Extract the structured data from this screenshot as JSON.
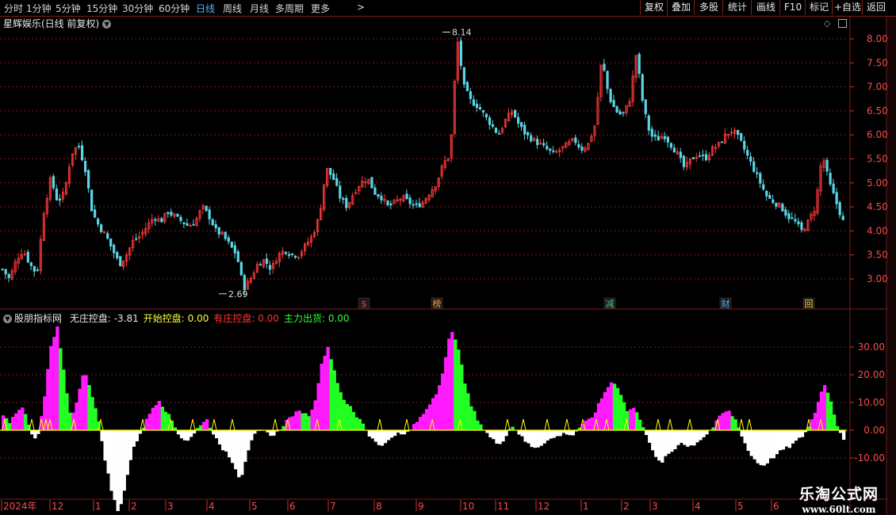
{
  "toolbar": {
    "periods": [
      {
        "label": "分时",
        "x": 5
      },
      {
        "label": "1分钟",
        "x": 33
      },
      {
        "label": "5分钟",
        "x": 70
      },
      {
        "label": "15分钟",
        "x": 109
      },
      {
        "label": "30分钟",
        "x": 154
      },
      {
        "label": "60分钟",
        "x": 200
      },
      {
        "label": "日线",
        "x": 247,
        "active": true
      },
      {
        "label": "周线",
        "x": 281
      },
      {
        "label": "月线",
        "x": 315
      },
      {
        "label": "多周期",
        "x": 347
      },
      {
        "label": "更多",
        "x": 392
      }
    ],
    "more_arrow": ">",
    "right_buttons": [
      {
        "label": "复权",
        "x": 807,
        "w": 34
      },
      {
        "label": "叠加",
        "x": 841,
        "w": 34
      },
      {
        "label": "多股",
        "x": 875,
        "w": 36
      },
      {
        "label": "统计",
        "x": 911,
        "w": 36
      },
      {
        "label": "画线",
        "x": 947,
        "w": 36
      },
      {
        "label": "F10",
        "x": 983,
        "w": 32
      },
      {
        "label": "标记",
        "x": 1015,
        "w": 34
      },
      {
        "label": "+自选",
        "x": 1049,
        "w": 38
      },
      {
        "label": "返回",
        "x": 1087,
        "w": 34
      }
    ]
  },
  "main_chart": {
    "title": "星辉娱乐(日线 前复权)",
    "dropdown_icon": "chevron-down-icon",
    "price_labels": [
      "8.00",
      "7.50",
      "7.00",
      "6.50",
      "6.00",
      "5.50",
      "5.00",
      "4.50",
      "4.00",
      "3.50",
      "3.00"
    ],
    "high_label": "8.14",
    "low_label": "2.69",
    "event_markers": [
      {
        "text": "$",
        "x": 453,
        "color": "#ff3b3b"
      },
      {
        "text": "榜",
        "x": 545,
        "color": "#ff9a3b"
      },
      {
        "text": "减",
        "x": 763,
        "color": "#3bd17a"
      },
      {
        "text": "财",
        "x": 909,
        "color": "#4fb4ff"
      },
      {
        "text": "回",
        "x": 1014,
        "color": "#ffd23b"
      }
    ]
  },
  "indicator": {
    "name": "股朋指标网",
    "items": [
      {
        "label": "无庄控盘:",
        "value": "-3.81",
        "color": "#e8e8e8"
      },
      {
        "label": "开始控盘:",
        "value": "0.00",
        "color": "#ffff33"
      },
      {
        "label": "有庄控盘:",
        "value": "0.00",
        "color": "#ff3333"
      },
      {
        "label": "主力出货:",
        "value": "0.00",
        "color": "#33ff33"
      }
    ],
    "y_labels": [
      "30.00",
      "20.00",
      "10.00",
      "0.00",
      "-10.00"
    ]
  },
  "date_axis": [
    {
      "label": "2024年",
      "x": 2
    },
    {
      "label": "12",
      "x": 63
    },
    {
      "label": "1",
      "x": 118
    },
    {
      "label": "2",
      "x": 163
    },
    {
      "label": "3",
      "x": 209
    },
    {
      "label": "4",
      "x": 261
    },
    {
      "label": "5",
      "x": 315
    },
    {
      "label": "6",
      "x": 363
    },
    {
      "label": "7",
      "x": 414
    },
    {
      "label": "8",
      "x": 472
    },
    {
      "label": "9",
      "x": 525
    },
    {
      "label": "10",
      "x": 581
    },
    {
      "label": "11",
      "x": 625
    },
    {
      "label": "12",
      "x": 676
    },
    {
      "label": "1",
      "x": 733
    },
    {
      "label": "2",
      "x": 784
    },
    {
      "label": "3",
      "x": 820
    },
    {
      "label": "4",
      "x": 874
    },
    {
      "label": "5",
      "x": 928
    },
    {
      "label": "6",
      "x": 973
    }
  ],
  "watermark": {
    "line1": "乐淘公式网",
    "line2": "www.60lt.com"
  },
  "colors": {
    "up": "#ff3b3b",
    "down": "#5bd6e6",
    "magenta": "#ff1aff",
    "green": "#22ff22",
    "white": "#ffffff",
    "yellow": "#ffff00",
    "grid": "#7a1e1e"
  },
  "chart_data": {
    "type": "candlestick",
    "ylim": [
      2.6,
      8.3
    ],
    "close_path": [
      3.2,
      3.0,
      3.4,
      3.6,
      3.3,
      3.1,
      4.4,
      5.1,
      4.6,
      4.8,
      5.6,
      5.8,
      5.3,
      4.4,
      4.1,
      3.9,
      3.6,
      3.3,
      3.5,
      3.8,
      3.9,
      4.1,
      4.3,
      4.2,
      4.4,
      4.3,
      4.2,
      4.1,
      4.2,
      4.5,
      4.3,
      4.0,
      3.9,
      3.7,
      3.5,
      2.8,
      3.0,
      3.3,
      3.4,
      3.2,
      3.5,
      3.6,
      3.5,
      3.5,
      3.7,
      3.9,
      4.3,
      5.3,
      5.1,
      4.7,
      4.5,
      4.8,
      5.0,
      5.1,
      4.8,
      4.7,
      4.5,
      4.6,
      4.7,
      4.6,
      4.5,
      4.6,
      4.8,
      5.0,
      5.4,
      5.6,
      8.0,
      7.0,
      6.7,
      6.6,
      6.4,
      6.2,
      6.0,
      6.3,
      6.5,
      6.2,
      6.0,
      5.9,
      5.8,
      5.7,
      5.6,
      5.7,
      5.8,
      5.9,
      5.7,
      5.8,
      6.2,
      7.6,
      6.8,
      6.5,
      6.4,
      6.7,
      7.7,
      6.6,
      6.0,
      5.9,
      6.0,
      5.8,
      5.6,
      5.3,
      5.5,
      5.6,
      5.5,
      5.7,
      5.8,
      6.0,
      6.1,
      5.9,
      5.6,
      5.3,
      5.0,
      4.7,
      4.6,
      4.5,
      4.3,
      4.2,
      4.0,
      4.2,
      4.5,
      5.6,
      5.0,
      4.6,
      4.2
    ],
    "osc_path": [
      5,
      3,
      7,
      9,
      -1,
      -4,
      10,
      30,
      37,
      20,
      4,
      12,
      22,
      14,
      4,
      -10,
      -22,
      -30,
      -20,
      -8,
      -2,
      3,
      8,
      11,
      7,
      3,
      -2,
      -4,
      -2,
      2,
      4,
      -1,
      -6,
      -8,
      -12,
      -18,
      -8,
      -2,
      0,
      -1,
      -2,
      1,
      4,
      6,
      7,
      5,
      10,
      25,
      30,
      20,
      12,
      9,
      5,
      3,
      -2,
      -4,
      -6,
      -3,
      -1,
      -2,
      0,
      3,
      6,
      10,
      14,
      22,
      36,
      32,
      18,
      9,
      4,
      0,
      -3,
      -5,
      -3,
      2,
      -1,
      -4,
      -6,
      -6,
      -4,
      -3,
      -2,
      -1,
      -2,
      1,
      3,
      5,
      10,
      15,
      18,
      14,
      7,
      8,
      4,
      -2,
      -9,
      -12,
      -9,
      -7,
      -4,
      -6,
      -5,
      -3,
      -1,
      2,
      6,
      7,
      4,
      -2,
      -8,
      -11,
      -13,
      -11,
      -9,
      -7,
      -6,
      -4,
      -2,
      2,
      8,
      17,
      12,
      2,
      -3
    ]
  }
}
